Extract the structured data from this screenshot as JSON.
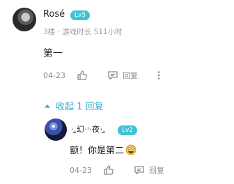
{
  "comment": {
    "author": "Rosé",
    "level": "Lv5",
    "meta": "3楼 · 游戏时长 511小时",
    "content": "第一",
    "date": "04-23",
    "reply_label": "回复",
    "like_icon": "thumb-up-icon",
    "reply_icon": "comment-icon",
    "more_icon": "more-vertical-icon"
  },
  "collapse": {
    "label": "收起 1 回复",
    "icon": "caret-up-icon",
    "color": "#2fa9c5"
  },
  "reply": {
    "author": "·.̫幻·ᵎ·夜·.̫",
    "level": "Lv2",
    "content": "额！你是第二",
    "emoji": "grinning-face-emoji",
    "date": "04-23",
    "reply_label": "回复"
  },
  "colors": {
    "badge": "#3fc2d6",
    "accent": "#2fa9c5",
    "muted": "#9a9a9a"
  }
}
